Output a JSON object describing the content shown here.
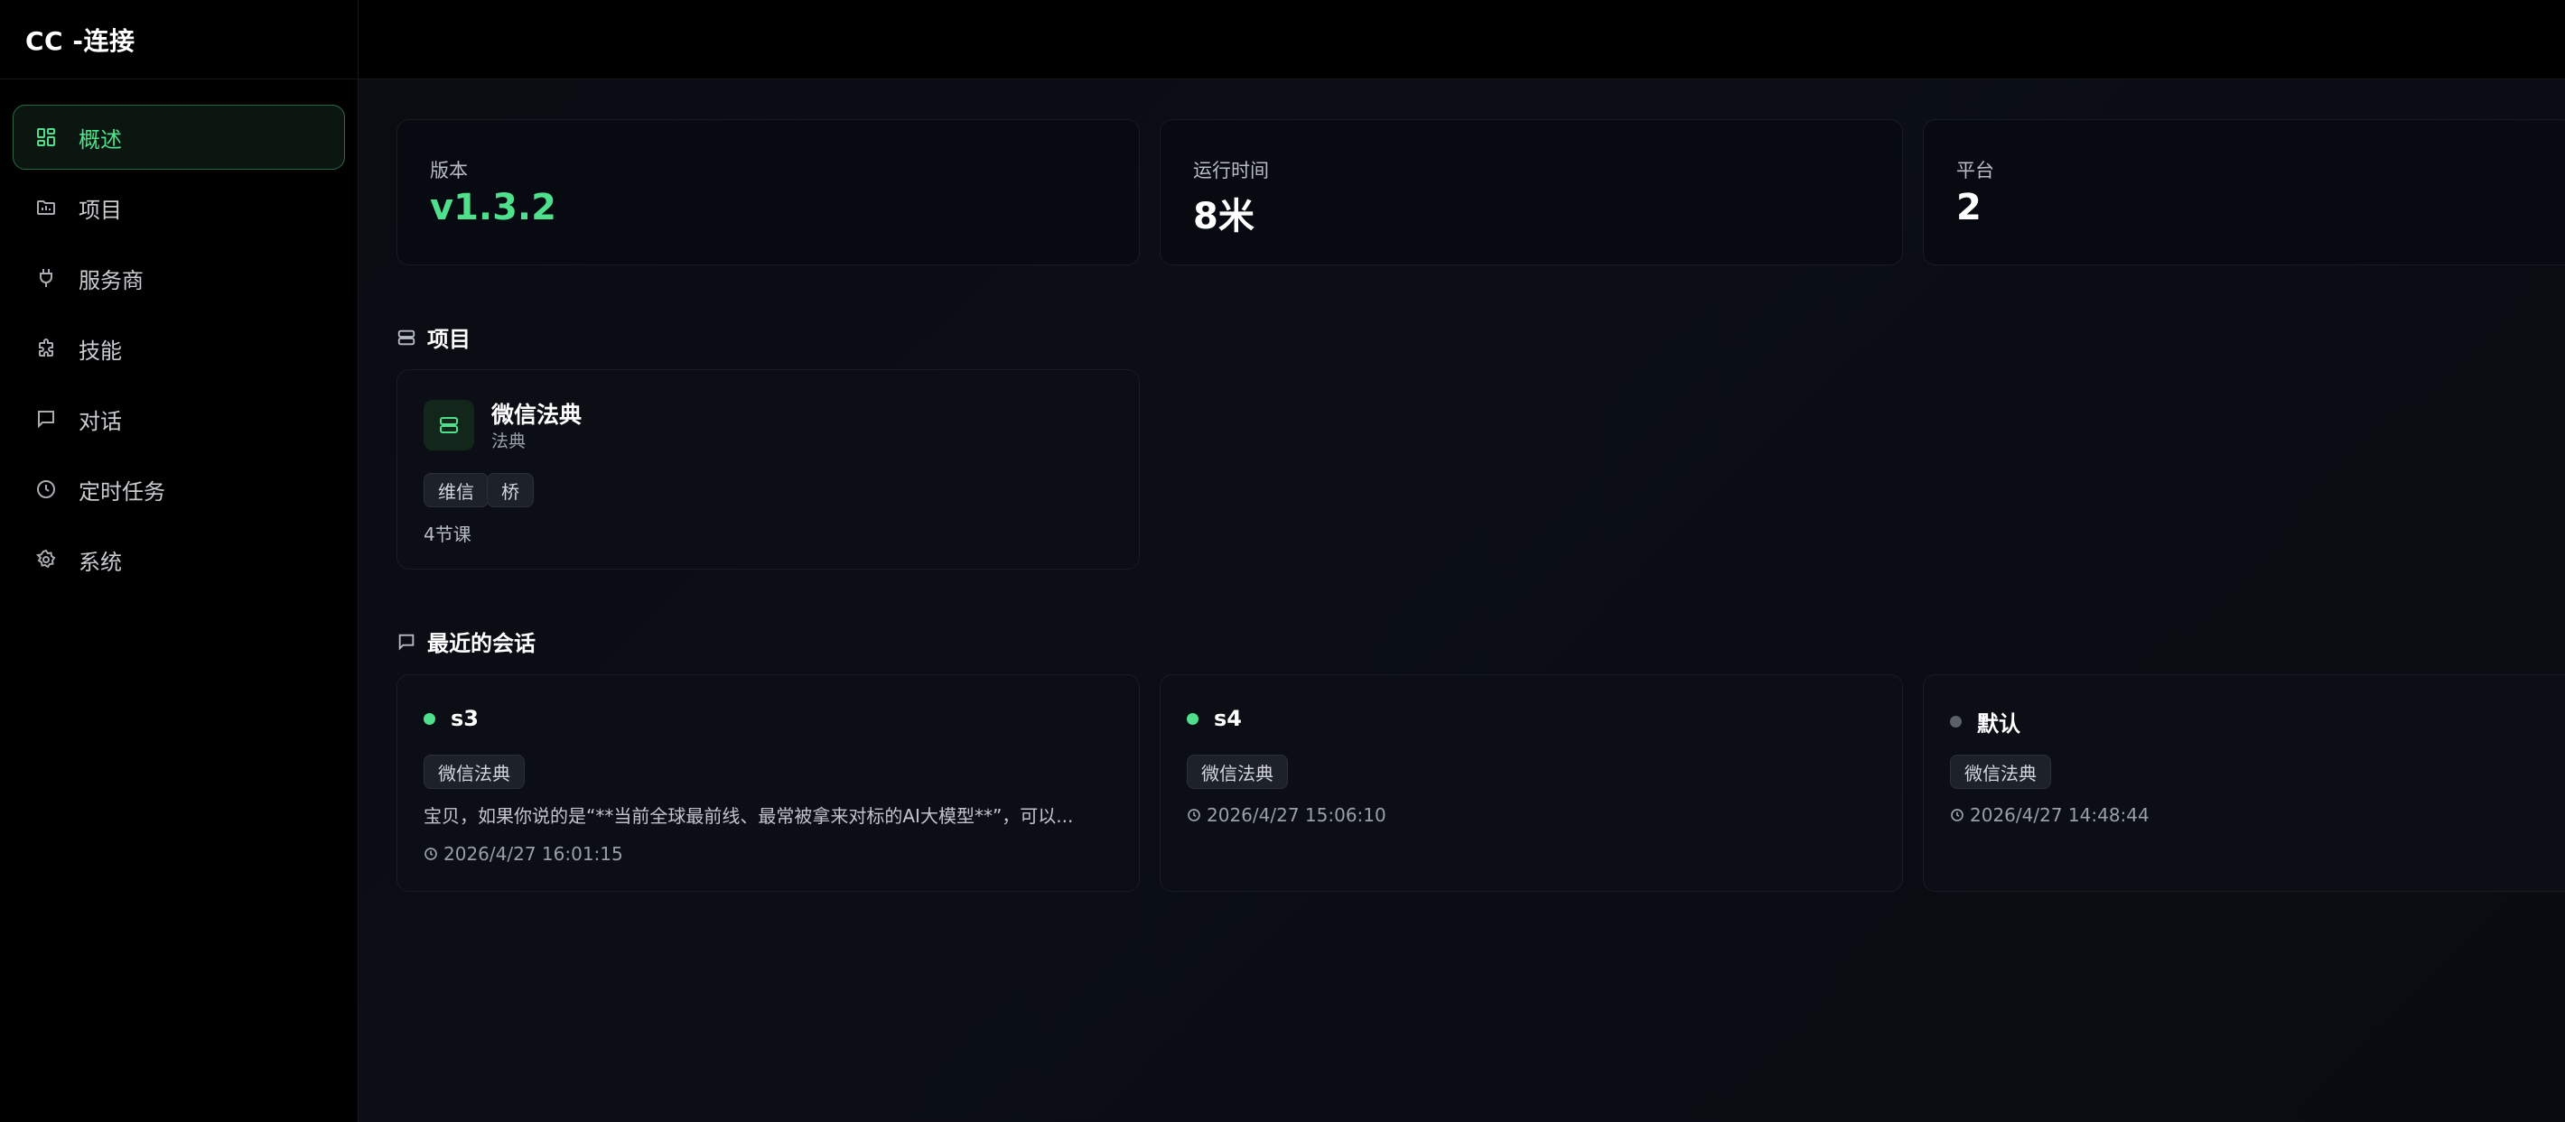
{
  "app": {
    "title": "CC -连接"
  },
  "sidebar": {
    "items": [
      {
        "label": "概述",
        "icon": "dashboard-icon",
        "active": true
      },
      {
        "label": "项目",
        "icon": "folder-icon",
        "active": false
      },
      {
        "label": "服务商",
        "icon": "plug-icon",
        "active": false
      },
      {
        "label": "技能",
        "icon": "puzzle-icon",
        "active": false
      },
      {
        "label": "对话",
        "icon": "message-icon",
        "active": false
      },
      {
        "label": "定时任务",
        "icon": "clock-icon",
        "active": false
      },
      {
        "label": "系统",
        "icon": "gear-icon",
        "active": false
      }
    ]
  },
  "stats": [
    {
      "label": "版本",
      "value": "v1.3.2"
    },
    {
      "label": "运行时间",
      "value": "8米"
    },
    {
      "label": "平台",
      "value": "2"
    }
  ],
  "projects_section": {
    "title": "项目",
    "projects": [
      {
        "name": "微信法典",
        "subtitle": "法典",
        "tags": [
          "维信",
          "桥"
        ],
        "lessons": "4节课"
      }
    ]
  },
  "sessions_section": {
    "title": "最近的会话",
    "sessions": [
      {
        "name": "s3",
        "status": "active",
        "project": "微信法典",
        "preview": "宝贝，如果你说的是“**当前全球最前线、最常被拿来对标的AI大模型**”，可以...",
        "time": "2026/4/27 16:01:15"
      },
      {
        "name": "s4",
        "status": "active",
        "project": "微信法典",
        "preview": "",
        "time": "2026/4/27 15:06:10"
      },
      {
        "name": "默认",
        "status": "inactive",
        "project": "微信法典",
        "preview": "",
        "time": "2026/4/27 14:48:44"
      }
    ]
  },
  "colors": {
    "accent": "#4ee08c",
    "background": "#000000",
    "card": "#070a10",
    "inactive_dot": "#5b6069"
  }
}
